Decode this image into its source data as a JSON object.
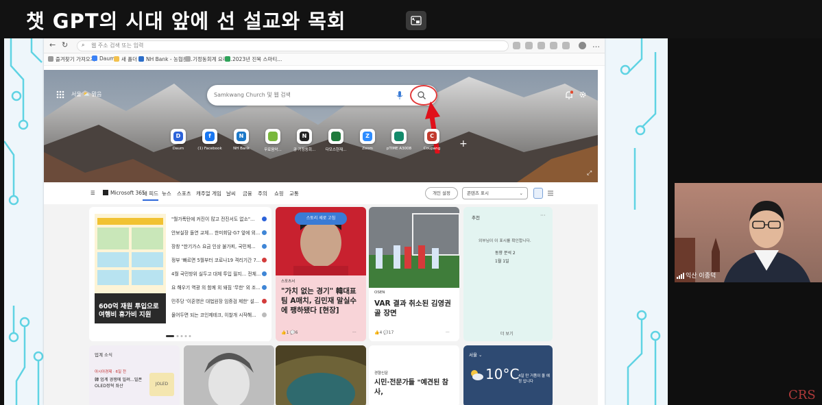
{
  "video_title": "챗 GPT의 시대 앞에 선 설교와 목회",
  "watermark": "CRS",
  "browser": {
    "address_placeholder": "웹 주소 검색 또는 입력",
    "bookmarks": [
      "즐겨찾기 가져오기",
      "Daum",
      "새 폴더",
      "NH Bank - 농협은...",
      "기정동회계 요리...",
      "2023년 진목 스마티..."
    ]
  },
  "hero": {
    "weather_text": "서울 ⛅ 맑음",
    "search_placeholder": "Samkwang Church 및 웹 검색",
    "quicklinks": [
      {
        "glyph": "D",
        "label": "Daum"
      },
      {
        "glyph": "f",
        "label": "(1) Facebook"
      },
      {
        "glyph": "N",
        "label": "NH Bank"
      },
      {
        "label": "무료음악..."
      },
      {
        "glyph": "N",
        "label": "공 기정동회..."
      },
      {
        "label": "다모스헌재..."
      },
      {
        "glyph": "Z",
        "label": "Zoom"
      },
      {
        "label": "pTIME A3008"
      },
      {
        "glyph": "C",
        "label": "Coupang"
      }
    ],
    "add_glyph": "+",
    "expand_glyph": "⤢"
  },
  "feed_nav": {
    "menu_glyph": "☰",
    "tabs": [
      "Microsoft 365",
      "내 피드",
      "뉴스",
      "스포츠",
      "캐주얼 게임",
      "날씨",
      "금융",
      "주의",
      "쇼핑",
      "교통"
    ],
    "personalize_label": "개인 설정",
    "content_select": "콘텐츠 표시"
  },
  "feed": {
    "more_glyph": "···",
    "list_card": {
      "headline": "600억 재원 투입으로 여행비 휴가비 지원",
      "items": [
        "\"월가폭탄에 커진이 많고 전진서도 없소\"...",
        "안보실장 돌연 교체... 한미회담·G7 앞에 외...",
        "장창 \"한기가스 요금 인상 불가피, 국민께...",
        "정부 '빠르면 5월부터 코로나19 격리기간 7...",
        "4월 국민방위 실두고 대체 투입 필지... 전체...",
        "요 해우기 역광 의 함께 외 돼짐 '무한' 외 조...",
        "민주당 '이혼영은 대법원장 임증검 제한' 설...",
        "물어두면 되는 코인제테크, 이찰개 시작해..."
      ]
    },
    "card2": {
      "pill": "스토리 세로 고침",
      "source": "스포츠서",
      "headline": "\"가치 없는 경기\" 韓대표팀 A매치, 김민재 말실수에 팽하됐다 [현장]",
      "meta": "👍1  💬6"
    },
    "card3": {
      "source": "OSEN",
      "headline": "VAR 결과 취소된 김영권 골 장면",
      "meta": "👍4  💬17"
    },
    "widget": {
      "title": "추천",
      "message": "외부님이 이 표시를 확인합니다.",
      "line1": "동향 분석 2",
      "line2": "1월 1일",
      "footer": "더 보기"
    },
    "row2": {
      "industry_title": "업계 소식",
      "industry_source": "아시아경제 · 6일 전",
      "industry_headline": "韓 업계 경쟁에 밀려...밀폰 OLED정혁 좌산",
      "logo_text": "JOLED",
      "card4_source": "경향신문",
      "card4_headline": "시민·전문가들 \"예견된 참사,"
    },
    "weather": {
      "location": "서울 ⌄",
      "temp": "10°C",
      "note": "4일 만 거품이 올 예정 입니다"
    }
  },
  "webcam": {
    "speaker_name": "익산 이종덕"
  }
}
